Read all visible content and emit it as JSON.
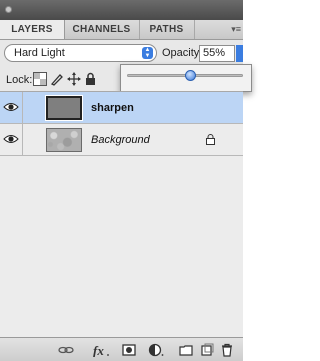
{
  "tabs": [
    {
      "label": "LAYERS"
    },
    {
      "label": "CHANNELS"
    },
    {
      "label": "PATHS"
    }
  ],
  "panel_menu_icon": "panel-menu-icon",
  "blend_mode": {
    "value": "Hard Light"
  },
  "opacity": {
    "label": "Opacity:",
    "value": "55%",
    "slider_fraction": 0.55
  },
  "lock": {
    "label": "Lock:",
    "icons": [
      "lock-transparent-pixels-icon",
      "lock-image-pixels-icon",
      "lock-position-icon",
      "lock-all-icon"
    ]
  },
  "layers": [
    {
      "name": "sharpen",
      "visible": true,
      "selected": true,
      "thumbnail": "gray-fill"
    },
    {
      "name": "Background",
      "visible": true,
      "selected": false,
      "locked": true,
      "thumbnail": "noise"
    }
  ],
  "bottom_icons": [
    "link-icon",
    "fx-icon",
    "mask-icon",
    "adjustment-icon",
    "group-folder-icon",
    "new-layer-icon",
    "trash-icon"
  ],
  "colors": {
    "selection": "#bcd5f5",
    "accent": "#3b7de0"
  }
}
